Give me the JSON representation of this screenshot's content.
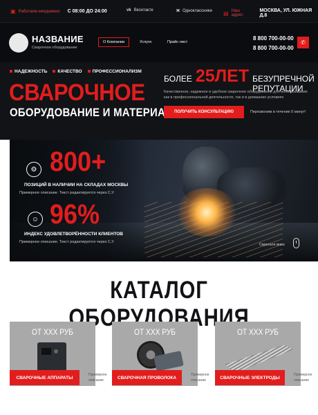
{
  "topbar": {
    "hours_label": "Работаем ежедневно:",
    "hours_value": "С 08:00 ДО 24:00",
    "social_vk": "Вконтакте",
    "social_ok": "Одноклассники",
    "address_label": "Наш адрес:",
    "address_value": "МОСКВА, УЛ. ЮЖНАЯ Д.8"
  },
  "header": {
    "brand_name": "НАЗВАНИЕ",
    "brand_sub": "Сварочное оборудование",
    "nav": [
      "О Компании",
      "Услуги",
      "Прайс-лист"
    ],
    "phones": [
      "8 800 700-00-00",
      "8 800 700-00-00"
    ]
  },
  "hero": {
    "taglines": [
      "НАДЕЖНОСТЬ",
      "КАЧЕСТВО",
      "ПРОФЕССИОНАЛИЗМ"
    ],
    "title": "СВАРОЧНОЕ",
    "subtitle": "ОБОРУДОВАНИЕ И МАТЕРИАЛЫ",
    "exp_pre": "БОЛЕЕ",
    "exp_num": "25ЛЕТ",
    "exp_post": "БЕЗУПРЕЧНОЙ РЕПУТАЦИИ",
    "description": "Качественное, надежное и удобное сварочное оборудование для использования как в профессиональной деятельности, так и в домашних условиях",
    "cta": "ПОЛУЧИТЬ КОНСУЛЬТАЦИЮ",
    "callback_note": "Перезвоним в течение 5 минут!"
  },
  "stats": [
    {
      "value": "800+",
      "label": "ПОЗИЦИЙ В НАЛИЧИИ НА СКЛАДАХ МОСКВЫ",
      "desc": "Примерное описание. Текст редактируется через С.У."
    },
    {
      "value": "96%",
      "label": "ИНДЕКС УДОВЛЕТВОРЁННОСТИ КЛИЕНТОВ",
      "desc": "Примерное описание. Текст редактируется через С.У."
    }
  ],
  "scroll_hint": "Скрольте вниз",
  "catalog": {
    "title": "КАТАЛОГ ОБОРУДОВАНИЯ",
    "items": [
      {
        "price": "ОТ ХХХ РУБ",
        "label": "СВАРОЧНЫЕ АППАРАТЫ",
        "desc": "Примерное описание"
      },
      {
        "price": "ОТ ХХХ РУБ",
        "label": "СВАРОЧНАЯ ПРОВОЛОКА",
        "desc": "Примерное описание"
      },
      {
        "price": "ОТ ХХХ РУБ",
        "label": "СВАРОЧНЫЕ ЭЛЕКТРОДЫ",
        "desc": "Примерное описание"
      }
    ]
  },
  "colors": {
    "accent": "#e21d1d",
    "dark": "#0f1114"
  }
}
